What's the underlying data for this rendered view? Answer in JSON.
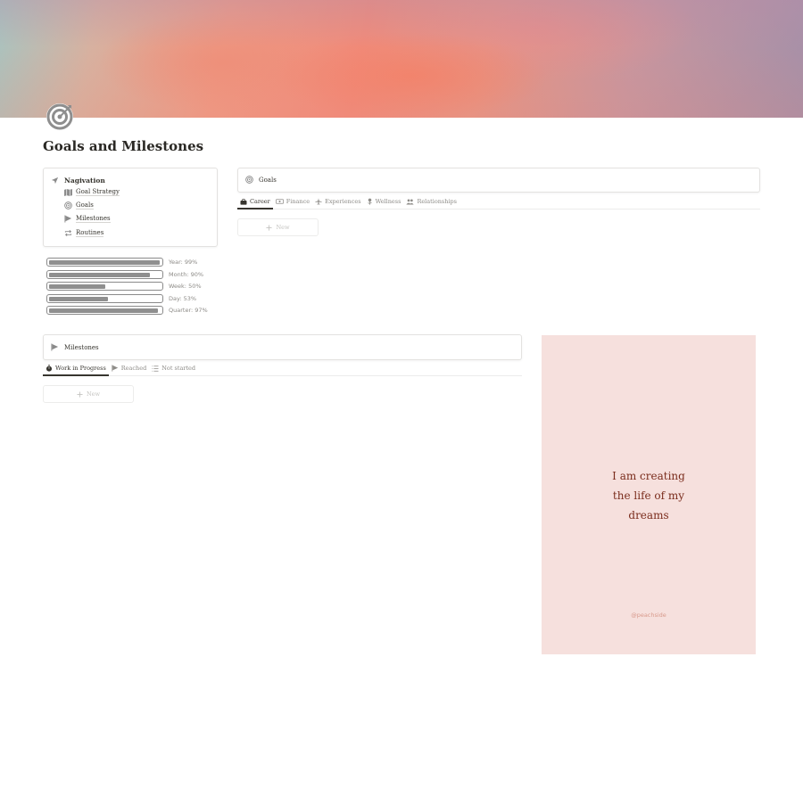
{
  "page": {
    "title": "Goals and Milestones",
    "icon": "target-icon"
  },
  "navigation": {
    "title": "Nagivation",
    "icon": "location-arrow-icon",
    "items": [
      {
        "label": "Goal Strategy",
        "icon": "map-icon"
      },
      {
        "label": "Goals",
        "icon": "target-icon"
      },
      {
        "label": "Milestones",
        "icon": "flag-icon"
      },
      {
        "label": "Routines",
        "icon": "repeat-icon"
      }
    ]
  },
  "progress": [
    {
      "label": "Year: 99%",
      "percent": 99
    },
    {
      "label": "Month: 90%",
      "percent": 90
    },
    {
      "label": "Week: 50%",
      "percent": 50
    },
    {
      "label": "Day: 53%",
      "percent": 53
    },
    {
      "label": "Quarter: 97%",
      "percent": 97
    }
  ],
  "goals": {
    "title": "Goals",
    "icon": "target-icon",
    "tabs": [
      {
        "label": "Career",
        "icon": "briefcase-icon",
        "active": true
      },
      {
        "label": "Finance",
        "icon": "money-icon",
        "active": false
      },
      {
        "label": "Experiences",
        "icon": "airplane-icon",
        "active": false
      },
      {
        "label": "Wellness",
        "icon": "flower-icon",
        "active": false
      },
      {
        "label": "Relationships",
        "icon": "people-icon",
        "active": false
      }
    ],
    "new_label": "New"
  },
  "milestones": {
    "title": "Milestones",
    "icon": "flag-icon",
    "tabs": [
      {
        "label": "Work in Progress",
        "icon": "stopwatch-icon",
        "active": true
      },
      {
        "label": "Reached",
        "icon": "flag-icon",
        "active": false
      },
      {
        "label": "Not started",
        "icon": "list-icon",
        "active": false
      }
    ],
    "new_label": "New"
  },
  "quote": {
    "lines": [
      "I am creating",
      "the life of my",
      "dreams"
    ],
    "handle": "@peachside"
  },
  "colors": {
    "cover_pink": "#f08b7b",
    "quote_bg": "#f6e0dd",
    "quote_text": "#7a2c1c",
    "bar_fill": "#8f8f8f"
  }
}
